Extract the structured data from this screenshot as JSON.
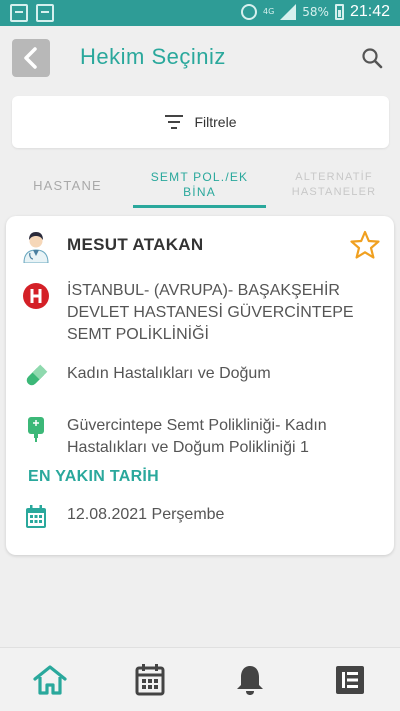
{
  "statusbar": {
    "network": "4G",
    "battery": "58%",
    "time": "21:42"
  },
  "header": {
    "title": "Hekim Seçiniz",
    "back_icon": "chevron-left-icon",
    "search_icon": "search-icon"
  },
  "filter": {
    "label": "Filtrele",
    "icon": "filter-icon"
  },
  "tabs": [
    {
      "label": "HASTANE",
      "active": false
    },
    {
      "label": "SEMT POL./EK BİNA",
      "active": true
    },
    {
      "label": "ALTERNATİF HASTANELER",
      "active": false
    }
  ],
  "card": {
    "doctor_name": "MESUT ATAKAN",
    "hospital": "İSTANBUL- (AVRUPA)- BAŞAKŞEHİR DEVLET HASTANESİ GÜVERCİNTEPE SEMT POLİKLİNİĞİ",
    "clinic": "Kadın Hastalıkları ve Doğum",
    "place": "Güvercintepe Semt Polikliniği- Kadın Hastalıkları ve Doğum Polikliniği 1",
    "nearest_label": "EN YAKIN TARİH",
    "date": "12.08.2021 Perşembe",
    "favorite": false
  },
  "bottom_nav": [
    "home-icon",
    "calendar-icon",
    "bell-icon",
    "list-icon"
  ],
  "colors": {
    "accent": "#2aa89c",
    "statusbar": "#2e9c96",
    "hospital_red": "#d42027",
    "star": "#f0a020"
  }
}
